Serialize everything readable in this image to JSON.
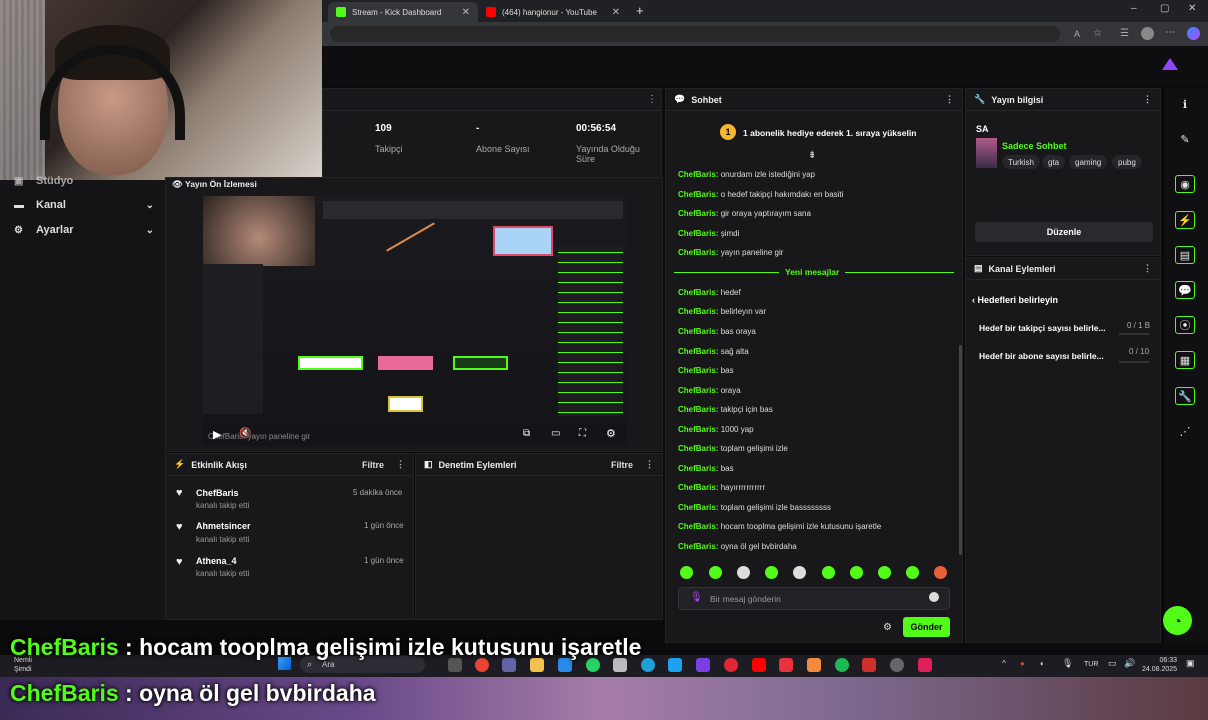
{
  "browser": {
    "tabs": [
      {
        "label": "Stream - Kick Dashboard",
        "favicon_color": "#53fc18"
      },
      {
        "label": "(464) hangionur - YouTube",
        "favicon_color": "#ff0000"
      }
    ],
    "new_tab": "+",
    "window_controls": [
      "–",
      "▢",
      "✕"
    ]
  },
  "sidebar": {
    "items": [
      {
        "label": "Stüdyo",
        "icon": "studio-icon"
      },
      {
        "label": "Kanal",
        "icon": "channel-icon"
      },
      {
        "label": "Ayarlar",
        "icon": "gear-icon"
      }
    ]
  },
  "stats": [
    {
      "value": "109",
      "label": "Takipçi"
    },
    {
      "value": "-",
      "label": "Abone Sayısı"
    },
    {
      "value": "00:56:54",
      "label": "Yayında Olduğu Süre"
    }
  ],
  "preview": {
    "title": "Yayın Ön İzlemesi",
    "overlay_text": "ChefBaris: yayın paneline gir"
  },
  "activity": {
    "title": "Etkinlik Akışı",
    "filter": "Filtre",
    "events": [
      {
        "name": "ChefBaris",
        "sub": "kanalı takip etti",
        "time": "5 dakika önce"
      },
      {
        "name": "Ahmetsincer",
        "sub": "kanalı takip etti",
        "time": "1 gün önce"
      },
      {
        "name": "Athena_4",
        "sub": "kanalı takip etti",
        "time": "1 gün önce"
      }
    ]
  },
  "moderation": {
    "title": "Denetim Eylemleri",
    "filter": "Filtre"
  },
  "chat": {
    "title": "Sohbet",
    "gift_banner": "1 abonelik hediye ederek 1. sıraya yükselin",
    "gift_badge": "1",
    "new_messages": "Yeni mesajlar",
    "old_messages": [
      {
        "user": "ChefBaris:",
        "text": "onurdam izle istediğini yap"
      },
      {
        "user": "ChefBaris:",
        "text": "o hedef takipçi hakımdakı en basiti"
      },
      {
        "user": "ChefBaris:",
        "text": "gir oraya yaptırayım sana"
      },
      {
        "user": "ChefBaris:",
        "text": "şimdi"
      },
      {
        "user": "ChefBaris:",
        "text": "yayın paneline gir"
      }
    ],
    "new_list": [
      {
        "user": "ChefBaris:",
        "text": "hedef"
      },
      {
        "user": "ChefBaris:",
        "text": "belirleyın var"
      },
      {
        "user": "ChefBaris:",
        "text": "bas oraya"
      },
      {
        "user": "ChefBaris:",
        "text": "sağ alta"
      },
      {
        "user": "ChefBaris:",
        "text": "bas"
      },
      {
        "user": "ChefBaris:",
        "text": "oraya"
      },
      {
        "user": "ChefBaris:",
        "text": "takipçi için bas"
      },
      {
        "user": "ChefBaris:",
        "text": "1000 yap"
      },
      {
        "user": "ChefBaris:",
        "text": "toplam gelişimi izle"
      },
      {
        "user": "ChefBaris:",
        "text": "bas"
      },
      {
        "user": "ChefBaris:",
        "text": "hayırrrrrrrrrrr"
      },
      {
        "user": "ChefBaris:",
        "text": "toplam gelişimi izle bassssssss"
      },
      {
        "user": "ChefBaris:",
        "text": "hocam tooplma gelişimi izle kutusunu işaretle"
      },
      {
        "user": "ChefBaris:",
        "text": "oyna öl gel bvbirdaha"
      }
    ],
    "input_placeholder": "Bir mesaj gönderin",
    "send_label": "Gönder"
  },
  "stream_info": {
    "title": "Yayın bilgisi",
    "stream_title": "SA",
    "category": "Sadece Sohbet",
    "tags": [
      "Turkish",
      "gta",
      "gaming",
      "pubg"
    ],
    "edit_label": "Düzenle"
  },
  "channel_actions": {
    "title": "Kanal Eylemleri",
    "subtitle": "Hedefleri belirleyin",
    "goals": [
      {
        "label": "Hedef bir takipçi sayısı belirle...",
        "value": "0 / 1 B",
        "progress": 0
      },
      {
        "label": "Hedef bir abone sayısı belirle...",
        "value": "0 / 10",
        "progress": 0
      }
    ]
  },
  "captions": [
    {
      "name": "ChefBaris",
      "text": " : hocam tooplma gelişimi izle kutusunu işaretle"
    },
    {
      "name": "ChefBaris",
      "text": " : oyna öl gel bvbirdaha"
    }
  ],
  "taskbar": {
    "search": "Ara",
    "weather": "Nemli",
    "weather_sub": "Şimdi",
    "lang": "TUR",
    "time": "06:33",
    "date": "24.08.2025"
  },
  "colors": {
    "accent": "#53fc18",
    "panel": "#18181b",
    "bg": "#0b0b0d"
  }
}
